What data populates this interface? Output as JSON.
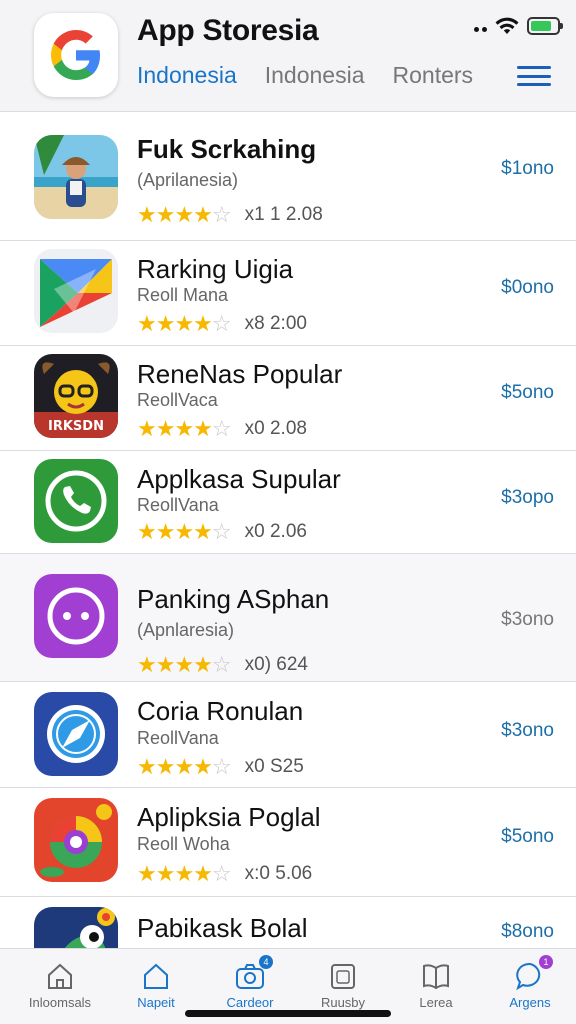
{
  "header": {
    "title": "App Storesia",
    "tabs": [
      "Indonesia",
      "Indonesia",
      "Ronters"
    ],
    "active_tab": 0
  },
  "status_bar": {
    "battery_level": 0.8,
    "battery_color": "#34c759"
  },
  "accent_color": "#1a75c9",
  "apps": [
    {
      "name": "Fuk Scrkahing",
      "subtitle": "(Aprilanesia)",
      "rating_stars": 4,
      "meta": "x1 1 2.08",
      "price": "$1ono",
      "icon": "beach-photo-icon"
    },
    {
      "name": "Rarking Uigia",
      "subtitle": "Reoll Mana",
      "rating_stars": 4,
      "meta": "x8  2:00",
      "price": "$0ono",
      "icon": "play-triangle-icon"
    },
    {
      "name": "ReneNas Popular",
      "subtitle": "ReollVaca",
      "rating_stars": 4,
      "meta": "x0  2.08",
      "price": "$5ono",
      "icon": "cartoon-character-icon",
      "icon_caption": "IRKSDN"
    },
    {
      "name": "Applkasa Supular",
      "subtitle": "ReollVana",
      "rating_stars": 4,
      "meta": "x0  2.06",
      "price": "$3opo",
      "icon": "phone-call-icon"
    },
    {
      "name": "Panking ASphan",
      "subtitle": "(Apnlaresia)",
      "rating_stars": 4,
      "meta": "x0)  624",
      "price": "$3ono",
      "icon": "chat-dots-icon"
    },
    {
      "name": "Coria Ronulan",
      "subtitle": "ReollVana",
      "rating_stars": 4,
      "meta": "x0  S25",
      "price": "$3ono",
      "icon": "compass-icon"
    },
    {
      "name": "Aplipksia Poglal",
      "subtitle": "Reoll Woha",
      "rating_stars": 4,
      "meta": "x:0   5.06",
      "price": "$5ono",
      "icon": "colorful-swirl-icon"
    },
    {
      "name": "Pabikask Bolal",
      "subtitle": "",
      "rating_stars": 0,
      "meta": "",
      "price": "$8ono",
      "icon": "cartoon-bird-icon"
    }
  ],
  "tabbar": [
    {
      "label": "Inloomsals",
      "icon": "home-outline-icon",
      "active": false
    },
    {
      "label": "Napeit",
      "icon": "house-icon",
      "active": true
    },
    {
      "label": "Cardeor",
      "icon": "camera-icon",
      "active": true,
      "badge": "4"
    },
    {
      "label": "Ruusby",
      "icon": "package-icon",
      "active": false
    },
    {
      "label": "Lerea",
      "icon": "book-open-icon",
      "active": false
    },
    {
      "label": "Argens",
      "icon": "chat-bubble-icon",
      "active": true,
      "badge": "1"
    }
  ]
}
